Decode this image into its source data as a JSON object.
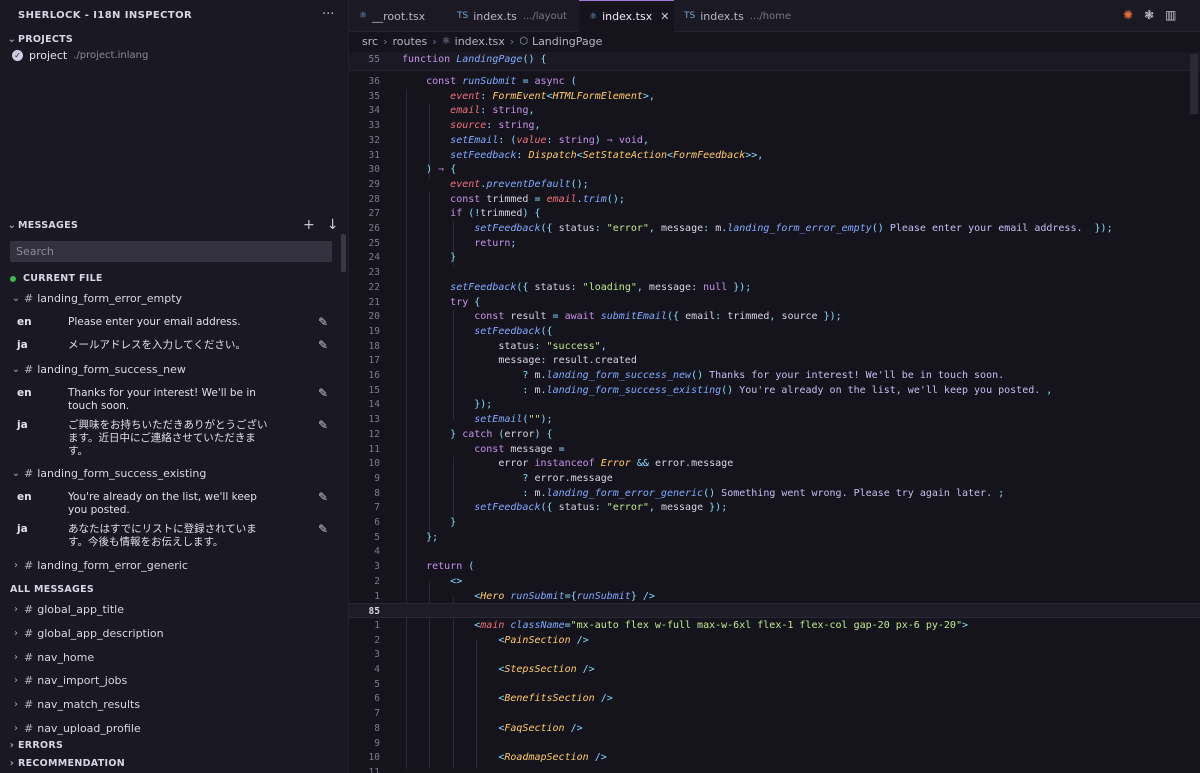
{
  "sidebar": {
    "title": "SHERLOCK - I18N INSPECTOR",
    "more": "···",
    "projects_heading": "PROJECTS",
    "project": {
      "name": "project",
      "path": "./project.inlang"
    },
    "messages_heading": "MESSAGES",
    "add_icon": "+",
    "download_icon": "↓",
    "search_placeholder": "Search",
    "current_file_heading": "CURRENT FILE",
    "current_file_messages": [
      {
        "key": "landing_form_error_empty",
        "en": "Please enter your email address.",
        "ja": "メールアドレスを入力してください。"
      },
      {
        "key": "landing_form_success_new",
        "en": "Thanks for your interest! We'll be in touch soon.",
        "ja": "ご興味をお持ちいただきありがとうございます。近日中にご連絡させていただきます。"
      },
      {
        "key": "landing_form_success_existing",
        "en": "You're already on the list, we'll keep you posted.",
        "ja": "あなたはすでにリストに登録されています。今後も情報をお伝えします。"
      },
      {
        "key": "landing_form_error_generic"
      }
    ],
    "all_messages_heading": "ALL MESSAGES",
    "all_messages": [
      "global_app_title",
      "global_app_description",
      "nav_home",
      "nav_import_jobs",
      "nav_match_results",
      "nav_upload_profile"
    ],
    "errors_heading": "ERRORS",
    "recommendation_heading": "RECOMMENDATION"
  },
  "tabs": [
    {
      "icon": "react-icon",
      "label": "__root.tsx",
      "sub": ""
    },
    {
      "icon": "TS",
      "label": "index.ts",
      "sub": ".../layout"
    },
    {
      "icon": "react-icon",
      "label": "index.tsx",
      "sub": "",
      "active": true,
      "close": "✕"
    },
    {
      "icon": "TS",
      "label": "index.ts",
      "sub": ".../home"
    }
  ],
  "breadcrumb": [
    "src",
    "routes",
    "index.tsx",
    "LandingPage"
  ],
  "editor": {
    "sticky": {
      "ln": "55",
      "html": "<span class='k'>function</span> <span class='f'>LandingPage</span><span class='p'>() {</span>"
    },
    "lines": [
      {
        "ln": "36",
        "html": "    <span class='k'>const</span> <span class='f'>runSubmit</span> <span class='p'>=</span> <span class='k'>async</span> <span class='p'>(</span>"
      },
      {
        "ln": "35",
        "html": "        <span class='pr'>event</span><span class='p'>:</span> <span class='t'>FormEvent</span><span class='p'>&lt;</span><span class='t'>HTMLFormElement</span><span class='p'>&gt;,</span>"
      },
      {
        "ln": "34",
        "html": "        <span class='pr'>email</span><span class='p'>:</span> <span class='k'>string</span><span class='p'>,</span>"
      },
      {
        "ln": "33",
        "html": "        <span class='pr'>source</span><span class='p'>:</span> <span class='k'>string</span><span class='p'>,</span>"
      },
      {
        "ln": "32",
        "html": "        <span class='f'>setEmail</span><span class='p'>:</span> <span class='p'>(</span><span class='pr'>value</span><span class='p'>:</span> <span class='k'>string</span><span class='p'>)</span> <span class='k'>⇒</span> <span class='k'>void</span><span class='p'>,</span>"
      },
      {
        "ln": "31",
        "html": "        <span class='f'>setFeedback</span><span class='p'>:</span> <span class='t'>Dispatch</span><span class='p'>&lt;</span><span class='t'>SetStateAction</span><span class='p'>&lt;</span><span class='t'>FormFeedback</span><span class='p'>&gt;&gt;,</span>"
      },
      {
        "ln": "30",
        "html": "    <span class='p'>)</span> <span class='k'>⇒</span> <span class='p'>{</span>"
      },
      {
        "ln": "29",
        "html": "        <span class='pr'>event</span><span class='p'>.</span><span class='f'>preventDefault</span><span class='p'>();</span>"
      },
      {
        "ln": "28",
        "html": "        <span class='k'>const</span> <span class='v'>trimmed</span> <span class='p'>=</span> <span class='pr'>email</span><span class='p'>.</span><span class='f'>trim</span><span class='p'>();</span>"
      },
      {
        "ln": "27",
        "html": "        <span class='k'>if</span> <span class='p'>(!</span><span class='v'>trimmed</span><span class='p'>) {</span>"
      },
      {
        "ln": "26",
        "html": "            <span class='f'>setFeedback</span><span class='p'>({</span> <span class='v'>status</span><span class='p'>:</span> <span class='s'>\"error\"</span><span class='p'>,</span> <span class='v'>message</span><span class='p'>:</span> <span class='v'>m</span><span class='p'>.</span><span class='f'>landing_form_error_empty</span><span class='p'>()</span> <span class='hint'>Please enter your email address.</span>  <span class='p'>});</span>"
      },
      {
        "ln": "25",
        "html": "            <span class='k'>return</span><span class='p'>;</span>"
      },
      {
        "ln": "24",
        "html": "        <span class='p'>}</span>"
      },
      {
        "ln": "23",
        "html": ""
      },
      {
        "ln": "22",
        "html": "        <span class='f'>setFeedback</span><span class='p'>({</span> <span class='v'>status</span><span class='p'>:</span> <span class='s'>\"loading\"</span><span class='p'>,</span> <span class='v'>message</span><span class='p'>:</span> <span class='k'>null</span> <span class='p'>});</span>"
      },
      {
        "ln": "21",
        "html": "        <span class='k'>try</span> <span class='p'>{</span>"
      },
      {
        "ln": "20",
        "html": "            <span class='k'>const</span> <span class='v'>result</span> <span class='p'>=</span> <span class='k'>await</span> <span class='f'>submitEmail</span><span class='p'>({</span> <span class='v'>email</span><span class='p'>:</span> <span class='v'>trimmed</span><span class='p'>,</span> <span class='v'>source</span> <span class='p'>});</span>"
      },
      {
        "ln": "19",
        "html": "            <span class='f'>setFeedback</span><span class='p'>({</span>"
      },
      {
        "ln": "18",
        "html": "                <span class='v'>status</span><span class='p'>:</span> <span class='s'>\"success\"</span><span class='p'>,</span>"
      },
      {
        "ln": "17",
        "html": "                <span class='v'>message</span><span class='p'>:</span> <span class='v'>result</span><span class='p'>.</span><span class='v'>created</span>"
      },
      {
        "ln": "16",
        "html": "                    <span class='p'>?</span> <span class='v'>m</span><span class='p'>.</span><span class='f'>landing_form_success_new</span><span class='p'>()</span> <span class='hint'>Thanks for your interest! We'll be in touch soon.</span>"
      },
      {
        "ln": "15",
        "html": "                    <span class='p'>:</span> <span class='v'>m</span><span class='p'>.</span><span class='f'>landing_form_success_existing</span><span class='p'>()</span> <span class='hint'>You're already on the list, we'll keep you posted.</span> <span class='p'>,</span>"
      },
      {
        "ln": "14",
        "html": "            <span class='p'>});</span>"
      },
      {
        "ln": "13",
        "html": "            <span class='f'>setEmail</span><span class='p'>(</span><span class='s'>\"\"</span><span class='p'>);</span>"
      },
      {
        "ln": "12",
        "html": "        <span class='p'>}</span> <span class='k'>catch</span> <span class='p'>(</span><span class='v'>error</span><span class='p'>) {</span>"
      },
      {
        "ln": "11",
        "html": "            <span class='k'>const</span> <span class='v'>message</span> <span class='p'>=</span>"
      },
      {
        "ln": "10",
        "html": "                <span class='v'>error</span> <span class='k'>instanceof</span> <span class='t'>Error</span> <span class='p'>&amp;&amp;</span> <span class='v'>error</span><span class='p'>.</span><span class='v'>message</span>"
      },
      {
        "ln": "9",
        "html": "                    <span class='p'>?</span> <span class='v'>error</span><span class='p'>.</span><span class='v'>message</span>"
      },
      {
        "ln": "8",
        "html": "                    <span class='p'>:</span> <span class='v'>m</span><span class='p'>.</span><span class='f'>landing_form_error_generic</span><span class='p'>()</span> <span class='hint'>Something went wrong. Please try again later.</span> <span class='p'>;</span>"
      },
      {
        "ln": "7",
        "html": "            <span class='f'>setFeedback</span><span class='p'>({</span> <span class='v'>status</span><span class='p'>:</span> <span class='s'>\"error\"</span><span class='p'>,</span> <span class='v'>message</span> <span class='p'>});</span>"
      },
      {
        "ln": "6",
        "html": "        <span class='p'>}</span>"
      },
      {
        "ln": "5",
        "html": "    <span class='p'>};</span>"
      },
      {
        "ln": "4",
        "html": ""
      },
      {
        "ln": "3",
        "html": "    <span class='k'>return</span> <span class='p'>(</span>"
      },
      {
        "ln": "2",
        "html": "        <span class='p'>&lt;&gt;</span>"
      },
      {
        "ln": "1",
        "html": "            <span class='p'>&lt;</span><span class='t'>Hero</span> <span class='c'>runSubmit</span><span class='p'>={</span><span class='f'>runSubmit</span><span class='p'>}</span> <span class='p'>/&gt;</span>"
      },
      {
        "ln": "85",
        "html": "",
        "cursor": true
      },
      {
        "ln": "1",
        "html": "            <span class='p'>&lt;</span><span class='pr'>main</span> <span class='c'>className</span><span class='p'>=</span><span class='s'>\"mx-auto flex w-full max-w-6xl flex-1 flex-col gap-20 px-6 py-20\"</span><span class='p'>&gt;</span>"
      },
      {
        "ln": "2",
        "html": "                <span class='p'>&lt;</span><span class='t'>PainSection</span> <span class='p'>/&gt;</span>"
      },
      {
        "ln": "3",
        "html": ""
      },
      {
        "ln": "4",
        "html": "                <span class='p'>&lt;</span><span class='t'>StepsSection</span> <span class='p'>/&gt;</span>"
      },
      {
        "ln": "5",
        "html": ""
      },
      {
        "ln": "6",
        "html": "                <span class='p'>&lt;</span><span class='t'>BenefitsSection</span> <span class='p'>/&gt;</span>"
      },
      {
        "ln": "7",
        "html": ""
      },
      {
        "ln": "8",
        "html": "                <span class='p'>&lt;</span><span class='t'>FaqSection</span> <span class='p'>/&gt;</span>"
      },
      {
        "ln": "9",
        "html": ""
      },
      {
        "ln": "10",
        "html": "                <span class='p'>&lt;</span><span class='t'>RoadmapSection</span> <span class='p'>/&gt;</span>"
      },
      {
        "ln": "11",
        "html": ""
      }
    ]
  },
  "colors": {
    "background": "#15141d",
    "sidebar": "#1a1923",
    "accent": "#9b7bd8",
    "status_dot": "#3fb950"
  }
}
